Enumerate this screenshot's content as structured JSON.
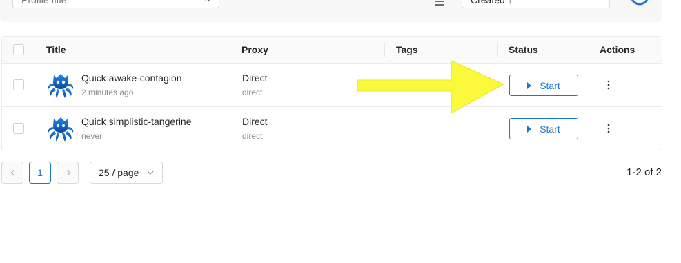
{
  "toolbar": {
    "search_placeholder": "Profile title",
    "sort_value": "Created ↑"
  },
  "table": {
    "columns": [
      "Title",
      "Proxy",
      "Tags",
      "Status",
      "Actions"
    ],
    "rows": [
      {
        "title": "Quick awake-contagion",
        "subtitle": "2 minutes ago",
        "proxy": "Direct",
        "proxy_type": "direct",
        "tags": "",
        "status_button": "Start"
      },
      {
        "title": "Quick simplistic-tangerine",
        "subtitle": "never",
        "proxy": "Direct",
        "proxy_type": "direct",
        "tags": "",
        "status_button": "Start"
      }
    ]
  },
  "pagination": {
    "current_page": "1",
    "page_size": "25 / page",
    "range_total": "1-2 of 2"
  },
  "colors": {
    "accent": "#1976d2",
    "annotation_arrow": "#fbf93c",
    "avatar_blue": "#1565c0"
  },
  "icons": {
    "search": "search-icon",
    "menu": "menu-icon",
    "refresh": "refresh-icon",
    "play": "play-icon",
    "more": "more-vertical-icon",
    "avatar": "octopus-avatar-icon"
  }
}
